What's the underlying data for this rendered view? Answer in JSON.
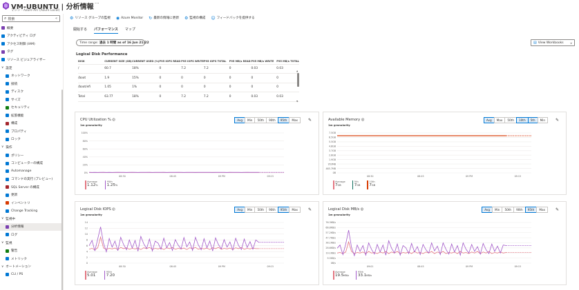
{
  "header": {
    "title": "VM-UBUNTU | 分析情報",
    "subtitle": "マシン - Azure Arc (Azure Local)",
    "star": "☆",
    "more": "···"
  },
  "search": {
    "placeholder": "検索",
    "collapse": "«"
  },
  "nav": [
    {
      "label": "概要",
      "kind": "top",
      "color": "#7a3fb0"
    },
    {
      "label": "アクティビティ ログ",
      "kind": "top",
      "color": "#0078d4"
    },
    {
      "label": "アクセス制御 (IAM)",
      "kind": "top",
      "color": "#0078d4"
    },
    {
      "label": "タグ",
      "kind": "top",
      "color": "#7a3fb0"
    },
    {
      "label": "リソース ビジュアライザー",
      "kind": "top",
      "color": "#0078d4"
    },
    {
      "label": "設定",
      "kind": "group"
    },
    {
      "label": "ネットワーク",
      "kind": "sub",
      "color": "#0078d4"
    },
    {
      "label": "接続",
      "kind": "sub",
      "color": "#0078d4"
    },
    {
      "label": "ディスク",
      "kind": "sub",
      "color": "#0078d4"
    },
    {
      "label": "サイズ",
      "kind": "sub",
      "color": "#0078d4"
    },
    {
      "label": "セキュリティ",
      "kind": "sub",
      "color": "#107c10"
    },
    {
      "label": "拡張機能",
      "kind": "sub",
      "color": "#0078d4"
    },
    {
      "label": "構成",
      "kind": "sub",
      "color": "#a4262c"
    },
    {
      "label": "プロパティ",
      "kind": "sub",
      "color": "#0078d4"
    },
    {
      "label": "ロック",
      "kind": "sub",
      "color": "#0078d4"
    },
    {
      "label": "操作",
      "kind": "group"
    },
    {
      "label": "ポリシー",
      "kind": "sub",
      "color": "#0078d4"
    },
    {
      "label": "コンピューターの構成",
      "kind": "sub",
      "color": "#0078d4"
    },
    {
      "label": "Automanage",
      "kind": "sub",
      "color": "#0078d4"
    },
    {
      "label": "コマンドの実行 (プレビュー)",
      "kind": "sub",
      "color": "#0078d4"
    },
    {
      "label": "SQL Server の構成",
      "kind": "sub",
      "color": "#a4262c"
    },
    {
      "label": "更新",
      "kind": "sub",
      "color": "#0078d4"
    },
    {
      "label": "インベントリ",
      "kind": "sub",
      "color": "#d83b01"
    },
    {
      "label": "Change Tracking",
      "kind": "sub",
      "color": "#0078d4"
    },
    {
      "label": "監視中",
      "kind": "group"
    },
    {
      "label": "分析情報",
      "kind": "sub",
      "color": "#7a3fb0",
      "selected": true
    },
    {
      "label": "ログ",
      "kind": "sub",
      "color": "#0078d4"
    },
    {
      "label": "監視",
      "kind": "group"
    },
    {
      "label": "警告",
      "kind": "sub",
      "color": "#107c10"
    },
    {
      "label": "メトリック",
      "kind": "sub",
      "color": "#0078d4"
    },
    {
      "label": "オートメーション",
      "kind": "group"
    },
    {
      "label": "CLI / PS",
      "kind": "sub",
      "color": "#0078d4"
    }
  ],
  "toolbar": [
    {
      "icon": "⚙",
      "label": "リソース グループの監視"
    },
    {
      "icon": "◉",
      "label": "Azure Monitor"
    },
    {
      "icon": "↻",
      "label": "最新の情報に更新"
    },
    {
      "icon": "⚙",
      "label": "監視の構成"
    },
    {
      "icon": "☺",
      "label": "フィードバックを提供する"
    }
  ],
  "tabs": [
    {
      "label": "開始する",
      "active": false
    },
    {
      "label": "パフォーマンス",
      "active": true
    },
    {
      "label": "マップ",
      "active": false
    }
  ],
  "time_range": {
    "label": "Time range:",
    "value": "過去 1 時間 as of 16 Jun 21:22"
  },
  "view_workbooks": {
    "label": "View Workbooks",
    "caret": "∨"
  },
  "disk_perf": {
    "title": "Logical Disk Performance",
    "columns": [
      "DISK",
      "CURRENT SIZE (GB)",
      "CURRENT USED (%)",
      "P95 IOPS READ",
      "P95 IOPS WRITE",
      "P95 IOPS TOTAL",
      "P95 MB/s READ",
      "P95 MB/s WRITE",
      "P95 MB/s TOTAL"
    ],
    "rows": [
      [
        "/",
        "60.7",
        "18%",
        "0",
        "7.2",
        "7.2",
        "0",
        "0.03",
        "0.03"
      ],
      [
        "/boot",
        "1.9",
        "15%",
        "0",
        "0",
        "0",
        "0",
        "0",
        "0"
      ],
      [
        "/boot/efi",
        "1.05",
        "1%",
        "0",
        "0",
        "0",
        "0",
        "0",
        "0"
      ],
      [
        "Total",
        "63.77",
        "18%",
        "0",
        "7.2",
        "7.2",
        "0",
        "0.03",
        "0.03"
      ]
    ]
  },
  "agg_options": [
    "Avg",
    "Min",
    "50th",
    "90th",
    "95th",
    "Max"
  ],
  "agg_options_mem": [
    "Avg",
    "Max",
    "50th",
    "10th",
    "5th",
    "Min"
  ],
  "colors": {
    "accent": "#0078d4",
    "series_avg": "#e2747f",
    "series_p95": "#a259c9",
    "mem_orange": "#d83b01",
    "mem_teal": "#0b6a5a"
  },
  "chart_data": [
    {
      "id": "cpu",
      "type": "line",
      "title": "CPU Utilization % ◎",
      "subtitle": "1m granularity",
      "y_ticks": [
        "100%",
        "80%",
        "60%",
        "40%",
        "20%",
        "0%"
      ],
      "ylim": [
        0,
        100
      ],
      "x_ticks": [
        "08:30",
        "08:45",
        "09 PM",
        "09:15"
      ],
      "active": [
        "Avg",
        "95th"
      ],
      "series": [
        {
          "name": "Average",
          "value": "1.12",
          "unit": "%",
          "color": "#e2747f",
          "values": [
            1.2,
            1.1,
            1.1,
            1.0,
            1.1,
            1.2,
            1.1,
            1.0,
            1.1,
            1.1,
            1.2,
            1.1,
            1.0,
            1.1,
            1.1,
            1.2,
            1.1,
            1.0,
            1.1,
            1.1,
            1.1,
            1.2,
            1.1,
            1.0,
            1.1,
            1.1,
            1.2,
            1.1,
            1.0,
            1.1,
            1.1,
            1.2,
            1.1,
            1.1,
            1.0,
            1.1,
            1.1,
            1.2,
            1.1,
            1.1,
            1.0,
            1.1,
            1.1,
            1.2,
            1.1,
            1.1,
            1.0,
            1.1,
            1.1,
            1.2,
            1.1,
            1.1,
            1.0,
            1.1,
            1.1,
            1.2,
            1.1,
            1.1,
            1.1,
            1.1
          ]
        },
        {
          "name": "95th",
          "value": "1.25",
          "unit": "%",
          "color": "#a259c9",
          "values": [
            1.3,
            1.2,
            1.3,
            1.2,
            1.3,
            1.4,
            1.2,
            1.3,
            1.2,
            1.3,
            1.3,
            1.4,
            1.3,
            1.2,
            1.3,
            1.3,
            1.3,
            1.2,
            1.3,
            1.3,
            1.3,
            1.3,
            1.2,
            1.3,
            1.3,
            1.3,
            1.3,
            1.2,
            1.3,
            1.3,
            1.3,
            1.3,
            1.3,
            1.2,
            1.3,
            1.3,
            1.3,
            1.2,
            1.3,
            1.3,
            1.3,
            1.3,
            1.3,
            1.2,
            1.3,
            1.3,
            1.3,
            1.3,
            1.2,
            1.3,
            1.3,
            1.3,
            1.3,
            1.2,
            1.3,
            1.3,
            1.3,
            1.3,
            1.3,
            1.3
          ]
        }
      ]
    },
    {
      "id": "mem",
      "type": "line",
      "title": "Available Memory ◎",
      "subtitle": "1m granularity",
      "y_ticks": [
        "7.5GB",
        "6.5GB",
        "5.5GB",
        "4.6GB",
        "3.7GB",
        "2.8GB",
        "1.9GB",
        "953MB",
        "465.7MB",
        "0B"
      ],
      "ylim": [
        0,
        7.5
      ],
      "x_ticks": [
        "08:30",
        "08:45",
        "09 PM",
        "09:15"
      ],
      "active": [
        "Avg",
        "10th",
        "5th"
      ],
      "series": [
        {
          "name": "Average",
          "value": "7",
          "unit": "GB",
          "color": "#e2747f",
          "values": [
            7.0,
            7.0,
            7.0,
            7.0,
            7.0,
            7.0,
            7.0,
            7.0,
            7.0,
            7.0,
            7.0,
            7.0,
            7.0,
            7.0,
            7.0,
            7.0,
            7.0,
            7.0,
            7.0,
            7.0,
            7.0,
            7.0,
            7.0,
            7.0,
            7.0,
            7.0,
            7.0,
            7.0,
            7.0,
            7.0,
            7.0,
            7.0,
            7.0,
            7.0,
            7.0,
            7.0,
            7.0,
            7.0,
            7.0,
            7.0,
            7.0,
            7.0,
            7.0,
            7.0,
            7.0,
            7.0,
            7.0,
            7.0,
            7.0,
            7.0,
            7.0,
            7.0,
            7.0,
            7.0,
            7.0,
            7.0,
            7.0,
            7.0,
            7.0,
            7.0
          ]
        },
        {
          "name": "5th",
          "value": "7",
          "unit": "GB",
          "color": "#0b6a5a",
          "values": [
            6.95,
            6.95,
            6.95,
            6.95,
            6.95,
            6.95,
            6.95,
            6.95,
            6.95,
            6.95,
            6.95,
            6.95,
            6.95,
            6.95,
            6.95,
            6.95,
            6.95,
            6.95,
            6.95,
            6.95,
            6.95,
            6.95,
            6.95,
            6.95,
            6.95,
            6.95,
            6.95,
            6.95,
            6.95,
            6.95,
            6.95,
            6.95,
            6.95,
            6.95,
            6.95,
            6.95,
            6.95,
            6.95,
            6.95,
            6.95,
            6.95,
            6.95,
            6.95,
            6.95,
            6.95,
            6.95,
            6.95,
            6.95,
            6.95,
            6.95,
            6.95,
            6.95,
            6.95,
            6.95,
            6.95,
            6.95,
            6.95,
            6.95,
            6.95,
            6.95
          ]
        },
        {
          "name": "10th",
          "value": "7",
          "unit": "GB",
          "color": "#d83b01",
          "values": [
            6.97,
            6.97,
            6.97,
            6.97,
            6.97,
            6.97,
            6.97,
            6.97,
            6.97,
            6.97,
            6.97,
            6.97,
            6.97,
            6.97,
            6.97,
            6.97,
            6.97,
            6.97,
            6.97,
            6.97,
            6.97,
            6.97,
            6.97,
            6.97,
            6.97,
            6.97,
            6.97,
            6.97,
            6.97,
            6.97,
            6.97,
            6.97,
            6.97,
            6.97,
            6.97,
            6.97,
            6.97,
            6.97,
            6.97,
            6.97,
            6.97,
            6.97,
            6.97,
            6.97,
            6.97,
            6.97,
            6.97,
            6.97,
            6.97,
            6.97,
            6.97,
            6.97,
            6.97,
            6.97,
            6.97,
            6.97,
            6.97,
            6.97,
            6.97,
            6.97
          ]
        }
      ]
    },
    {
      "id": "iops",
      "type": "line",
      "title": "Logical Disk IOPS ◎",
      "subtitle": "1m granularity",
      "y_ticks": [
        "14",
        "12",
        "10",
        "8",
        "6",
        "4",
        "2",
        "0"
      ],
      "ylim": [
        0,
        14
      ],
      "x_ticks": [
        "08:30",
        "08:45",
        "09 PM",
        "09:15"
      ],
      "active": [
        "Avg",
        "95th"
      ],
      "series": [
        {
          "name": "Average",
          "value": "5.01",
          "unit": "",
          "color": "#e2747f",
          "values": [
            4.8,
            5.1,
            4.6,
            5.3,
            9.0,
            5.2,
            4.8,
            5.1,
            4.9,
            5.2,
            4.7,
            5.4,
            5.0,
            5.3,
            4.8,
            5.1,
            4.9,
            5.2,
            4.7,
            5.3,
            5.0,
            5.4,
            4.8,
            5.1,
            4.9,
            5.2,
            4.7,
            5.3,
            5.0,
            5.4,
            4.8,
            5.1,
            4.9,
            5.2,
            4.7,
            5.3,
            5.0,
            5.4,
            4.8,
            5.1,
            4.9,
            5.2,
            4.7,
            5.3,
            5.0,
            5.4,
            4.8,
            5.1,
            4.9,
            5.2,
            4.7,
            5.3,
            5.0,
            5.4,
            4.8,
            5.1,
            4.9,
            5.2,
            5.0,
            5.0
          ]
        },
        {
          "name": "95th",
          "value": "7.20",
          "unit": "",
          "color": "#a259c9",
          "values": [
            6.0,
            7.8,
            4.2,
            8.4,
            12.5,
            6.9,
            3.9,
            8.5,
            5.5,
            7.6,
            4.3,
            8.9,
            6.4,
            4.6,
            8.0,
            5.2,
            7.8,
            4.1,
            9.2,
            6.7,
            5.0,
            8.3,
            4.2,
            7.6,
            6.9,
            4.8,
            8.6,
            5.3,
            7.1,
            4.4,
            8.1,
            6.2,
            4.9,
            8.8,
            5.6,
            7.3,
            4.4,
            8.9,
            6.3,
            4.6,
            8.4,
            5.3,
            7.6,
            4.2,
            8.7,
            6.4,
            4.9,
            8.1,
            5.5,
            7.3,
            4.5,
            8.6,
            6.1,
            4.7,
            8.3,
            5.4,
            7.4,
            4.8,
            8.0,
            7.2
          ]
        }
      ]
    },
    {
      "id": "mbs",
      "type": "line",
      "title": "Logical Disk MB/s ◎",
      "subtitle": "1m granularity",
      "y_ticks": [
        "76.3KB/s",
        "66.8KB/s",
        "57.2KB/s",
        "47.7KB/s",
        "38.1KB/s",
        "28.6KB/s",
        "19.1KB/s",
        "9.5KB/s",
        "0B/s"
      ],
      "ylim": [
        0,
        76.3
      ],
      "x_ticks": [
        "09:01",
        "08:45",
        "09 PM",
        "09:15"
      ],
      "active": [
        "Avg",
        "95th"
      ],
      "series": [
        {
          "name": "Average",
          "value": "19.5",
          "unit": "KB/s",
          "color": "#e2747f",
          "values": [
            19,
            20,
            18,
            21,
            40,
            22,
            18,
            20,
            19,
            21,
            18,
            22,
            19,
            20,
            18,
            21,
            19,
            22,
            18,
            21,
            19,
            22,
            18,
            20,
            19,
            21,
            18,
            22,
            19,
            20,
            18,
            21,
            19,
            22,
            18,
            21,
            19,
            22,
            18,
            20,
            19,
            21,
            18,
            22,
            19,
            20,
            18,
            21,
            19,
            22,
            18,
            21,
            19,
            22,
            18,
            20,
            19,
            21,
            19,
            20
          ]
        },
        {
          "name": "95th",
          "value": "33.1",
          "unit": "KB/s",
          "color": "#a259c9",
          "values": [
            28,
            34,
            16,
            36,
            62,
            30,
            14,
            34,
            22,
            33,
            15,
            38,
            26,
            17,
            35,
            21,
            34,
            15,
            42,
            28,
            19,
            36,
            15,
            33,
            29,
            18,
            37,
            21,
            31,
            16,
            35,
            25,
            19,
            38,
            23,
            32,
            16,
            38,
            26,
            17,
            36,
            21,
            33,
            15,
            38,
            26,
            19,
            35,
            22,
            31,
            17,
            37,
            25,
            18,
            36,
            22,
            32,
            19,
            34,
            33
          ]
        }
      ]
    }
  ]
}
